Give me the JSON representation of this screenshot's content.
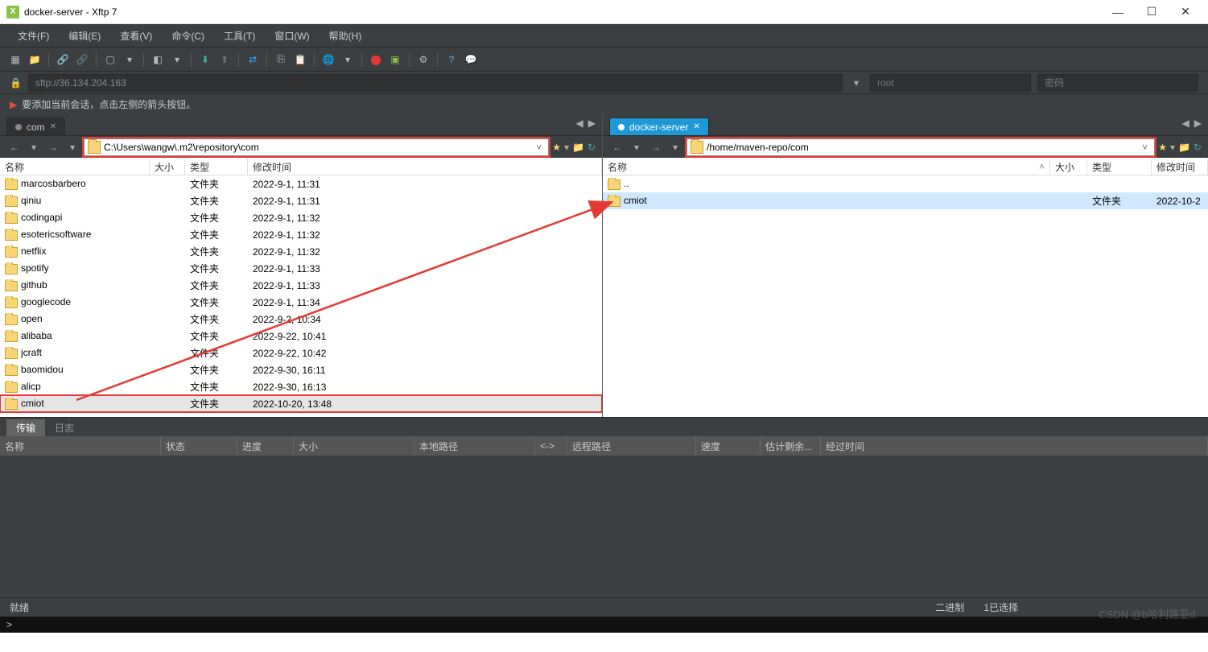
{
  "window": {
    "title": "docker-server - Xftp 7"
  },
  "menu": [
    "文件(F)",
    "编辑(E)",
    "查看(V)",
    "命令(C)",
    "工具(T)",
    "窗口(W)",
    "帮助(H)"
  ],
  "address": {
    "url": "sftp://36.134.204.163",
    "user_placeholder": "root",
    "pass_placeholder": "密码"
  },
  "info": "要添加当前会话，点击左侧的箭头按钮。",
  "tabs": {
    "left": "com",
    "right": "docker-server"
  },
  "paths": {
    "left": "C:\\Users\\wangw\\.m2\\repository\\com",
    "right": "/home/maven-repo/com"
  },
  "cols": {
    "name": "名称",
    "size": "大小",
    "type": "类型",
    "date": "修改时间"
  },
  "left_rows": [
    {
      "n": "marcosbarbero",
      "t": "文件夹",
      "d": "2022-9-1, 11:31"
    },
    {
      "n": "qiniu",
      "t": "文件夹",
      "d": "2022-9-1, 11:31"
    },
    {
      "n": "codingapi",
      "t": "文件夹",
      "d": "2022-9-1, 11:32"
    },
    {
      "n": "esotericsoftware",
      "t": "文件夹",
      "d": "2022-9-1, 11:32"
    },
    {
      "n": "netflix",
      "t": "文件夹",
      "d": "2022-9-1, 11:32"
    },
    {
      "n": "spotify",
      "t": "文件夹",
      "d": "2022-9-1, 11:33"
    },
    {
      "n": "github",
      "t": "文件夹",
      "d": "2022-9-1, 11:33"
    },
    {
      "n": "googlecode",
      "t": "文件夹",
      "d": "2022-9-1, 11:34"
    },
    {
      "n": "open",
      "t": "文件夹",
      "d": "2022-9-2, 10:34"
    },
    {
      "n": "alibaba",
      "t": "文件夹",
      "d": "2022-9-22, 10:41"
    },
    {
      "n": "jcraft",
      "t": "文件夹",
      "d": "2022-9-22, 10:42"
    },
    {
      "n": "baomidou",
      "t": "文件夹",
      "d": "2022-9-30, 16:11"
    },
    {
      "n": "alicp",
      "t": "文件夹",
      "d": "2022-9-30, 16:13"
    },
    {
      "n": "cmiot",
      "t": "文件夹",
      "d": "2022-10-20, 13:48"
    }
  ],
  "right_rows": [
    {
      "n": "..",
      "t": "",
      "d": ""
    },
    {
      "n": "cmiot",
      "t": "文件夹",
      "d": "2022-10-2"
    }
  ],
  "bottom_tabs": {
    "transfer": "传输",
    "log": "日志"
  },
  "transfer_cols": [
    "名称",
    "状态",
    "进度",
    "大小",
    "本地路径",
    "<->",
    "远程路径",
    "速度",
    "估计剩余...",
    "经过时间"
  ],
  "status": {
    "ready": "就绪",
    "binary": "二进制",
    "sel": "1已选择"
  },
  "watermark": "CSDN @b哈利路亚d.",
  "cmd_prompt": ">"
}
